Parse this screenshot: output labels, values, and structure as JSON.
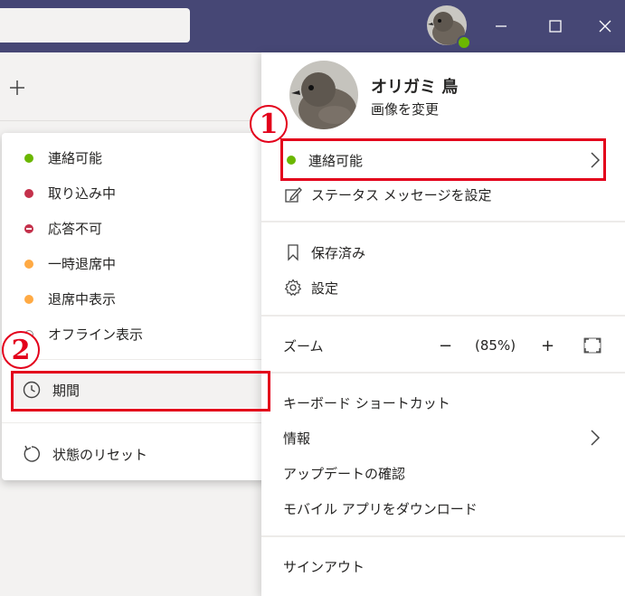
{
  "profile": {
    "name": "オリガミ 鳥",
    "change_image": "画像を変更",
    "status": "連絡可能",
    "set_status_message": "ステータス メッセージを設定",
    "saved": "保存済み",
    "settings": "設定",
    "zoom_label": "ズーム",
    "zoom_minus": "−",
    "zoom_value": "(85%)",
    "zoom_plus": "+",
    "keyboard_shortcuts": "キーボード ショートカット",
    "about": "情報",
    "check_updates": "アップデートの確認",
    "download_mobile": "モバイル アプリをダウンロード",
    "sign_out": "サインアウト"
  },
  "status_menu": {
    "items": [
      {
        "label": "連絡可能",
        "kind": "available"
      },
      {
        "label": "取り込み中",
        "kind": "busy"
      },
      {
        "label": "応答不可",
        "kind": "dnd"
      },
      {
        "label": "一時退席中",
        "kind": "away"
      },
      {
        "label": "退席中表示",
        "kind": "away"
      },
      {
        "label": "オフライン表示",
        "kind": "offline"
      }
    ],
    "duration": "期間",
    "reset": "状態のリセット"
  },
  "annotations": {
    "badge1": "1",
    "badge2": "2"
  },
  "colors": {
    "titlebar": "#464775",
    "available": "#6bb700",
    "busy": "#c4314b",
    "away": "#ffaa44",
    "highlight": "#e3001b"
  }
}
